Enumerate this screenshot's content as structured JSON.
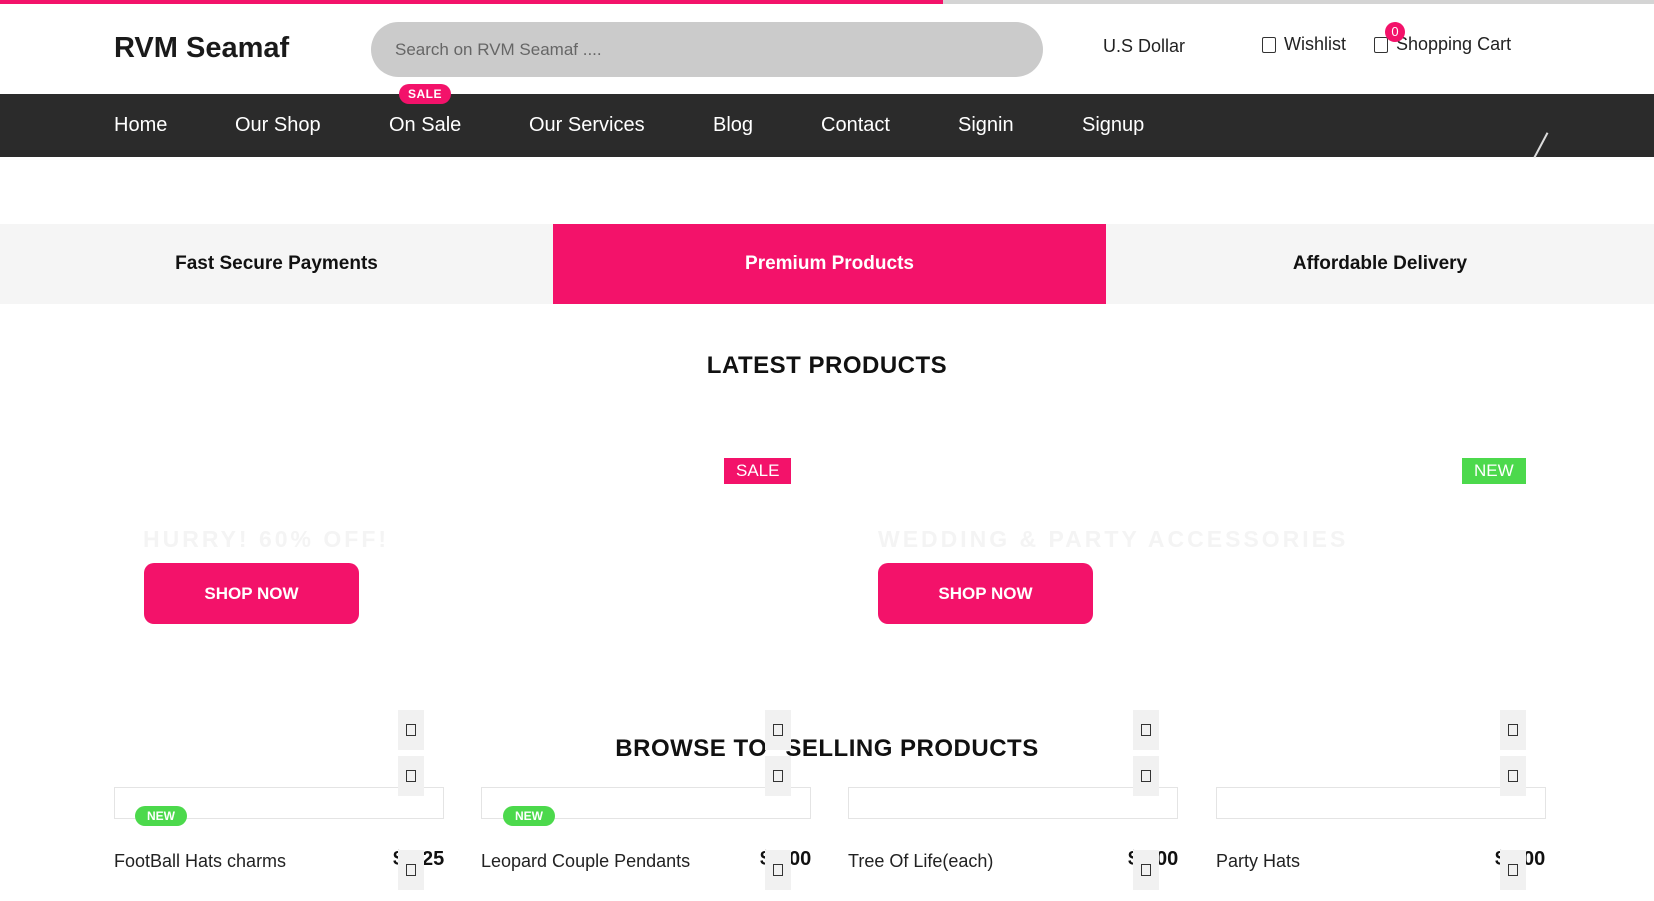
{
  "progress": {
    "value_percent": 57,
    "color": "#f3126a",
    "track_color": "#d4d4d4"
  },
  "header": {
    "logo": "RVM Seamaf",
    "search_placeholder": "Search on RVM Seamaf ....",
    "currency": "U.S Dollar",
    "wishlist_label": "Wishlist",
    "cart_label": "Shopping Cart",
    "cart_count": "0"
  },
  "nav": {
    "items": [
      "Home",
      "Our Shop",
      "On Sale",
      "Our Services",
      "Blog",
      "Contact",
      "Signin",
      "Signup"
    ],
    "sale_tag": "SALE"
  },
  "features": {
    "items": [
      "Fast Secure Payments",
      "Premium Products",
      "Affordable Delivery"
    ],
    "active_index": 1
  },
  "latest": {
    "title": "LATEST PRODUCTS",
    "banner_left": {
      "badge": "SALE",
      "text": "HURRY! 60% OFF!",
      "button": "SHOP NOW"
    },
    "banner_right": {
      "badge": "NEW",
      "text": "WEDDING & PARTY ACCESSORIES",
      "button": "SHOP NOW"
    }
  },
  "browse": {
    "title_left": "BROWSE TO",
    "title_right": "SELLING PRODUCTS",
    "products": [
      {
        "name": "FootBall Hats charms",
        "price_left": "$",
        "price_right": "25",
        "badge": "NEW"
      },
      {
        "name": "Leopard Couple Pendants",
        "price_left": "$",
        "price_right": "00",
        "badge": "NEW"
      },
      {
        "name": "Tree Of Life(each)",
        "price_left": "$",
        "price_right": "00",
        "badge": ""
      },
      {
        "name": "Party Hats",
        "price_left": "$",
        "price_right": "00",
        "badge": ""
      }
    ]
  },
  "colors": {
    "accent": "#f3126a",
    "nav_bg": "#2b2b2b",
    "new_badge": "#4cd94c",
    "feature_bg": "#f5f5f5"
  }
}
